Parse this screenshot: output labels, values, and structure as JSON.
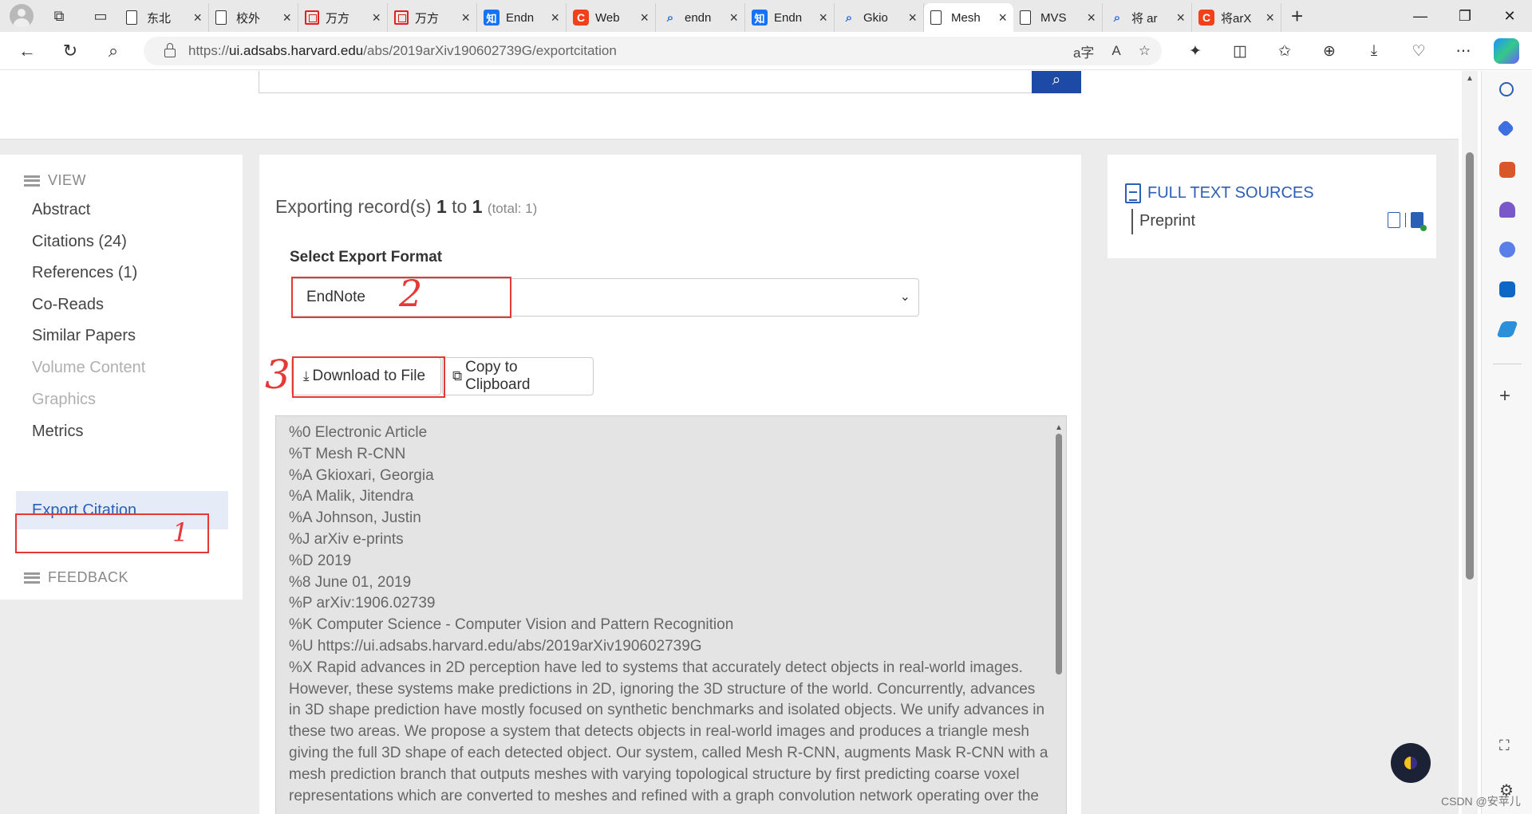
{
  "browser": {
    "tabs": [
      {
        "label": "东北",
        "icon": "doc"
      },
      {
        "label": "校外",
        "icon": "doc"
      },
      {
        "label": "万方",
        "icon": "wf"
      },
      {
        "label": "万方",
        "icon": "wf"
      },
      {
        "label": "Endn",
        "icon": "zhi"
      },
      {
        "label": "Web",
        "icon": "csdn"
      },
      {
        "label": "endn",
        "icon": "search"
      },
      {
        "label": "Endn",
        "icon": "zhi"
      },
      {
        "label": "Gkio",
        "icon": "search"
      },
      {
        "label": "Mesh",
        "icon": "doc",
        "active": true
      },
      {
        "label": "MVS",
        "icon": "doc"
      },
      {
        "label": "将 ar",
        "icon": "search"
      },
      {
        "label": "将arX",
        "icon": "csdn"
      }
    ],
    "url_prefix": "https://",
    "url_host": "ui.adsabs.harvard.edu",
    "url_path": "/abs/2019arXiv190602739G/exportcitation",
    "icons": {
      "zhi_glyph": "知",
      "csdn_glyph": "C"
    }
  },
  "nav": {
    "view_label": "VIEW",
    "items": [
      {
        "label": "Abstract",
        "disabled": false
      },
      {
        "label": "Citations (24)",
        "disabled": false
      },
      {
        "label": "References (1)",
        "disabled": false
      },
      {
        "label": "Co-Reads",
        "disabled": false
      },
      {
        "label": "Similar Papers",
        "disabled": false
      },
      {
        "label": "Volume Content",
        "disabled": true
      },
      {
        "label": "Graphics",
        "disabled": true
      },
      {
        "label": "Metrics",
        "disabled": false
      },
      {
        "label": "Export Citation",
        "active": true
      }
    ],
    "feedback_label": "FEEDBACK"
  },
  "export": {
    "exporting_prefix": "Exporting record(s) ",
    "from": "1",
    "to_word": " to ",
    "to": "1",
    "total": "(total: 1)",
    "format_label": "Select Export Format",
    "format_value": "EndNote",
    "download_label": "Download to File",
    "copy_label": "Copy to Clipboard",
    "output_lines": [
      "%0 Electronic Article",
      "%T Mesh R-CNN",
      "%A Gkioxari, Georgia",
      "%A Malik, Jitendra",
      "%A Johnson, Justin",
      "%J arXiv e-prints",
      "%D 2019",
      "%8 June 01, 2019",
      "%P arXiv:1906.02739",
      "%K Computer Science - Computer Vision and Pattern Recognition",
      "%U https://ui.adsabs.harvard.edu/abs/2019arXiv190602739G",
      "%X Rapid advances in 2D perception have led to systems that accurately detect objects in real-world images.",
      "However, these systems make predictions in 2D, ignoring the 3D structure of the world. Concurrently, advances",
      "in 3D shape prediction have mostly focused on synthetic benchmarks and isolated objects. We unify advances in",
      "these two areas. We propose a system that detects objects in real-world images and produces a triangle mesh",
      "giving the full 3D shape of each detected object. Our system, called Mesh R-CNN, augments Mask R-CNN with a",
      "mesh prediction branch that outputs meshes with varying topological structure by first predicting coarse voxel",
      "representations which are converted to meshes and refined with a graph convolution network operating over the"
    ]
  },
  "full_text": {
    "title": "FULL TEXT SOURCES",
    "preprint_label": "Preprint"
  },
  "annotations": {
    "one": "1",
    "two": "2",
    "three": "3"
  },
  "watermark": "CSDN @安苹儿"
}
